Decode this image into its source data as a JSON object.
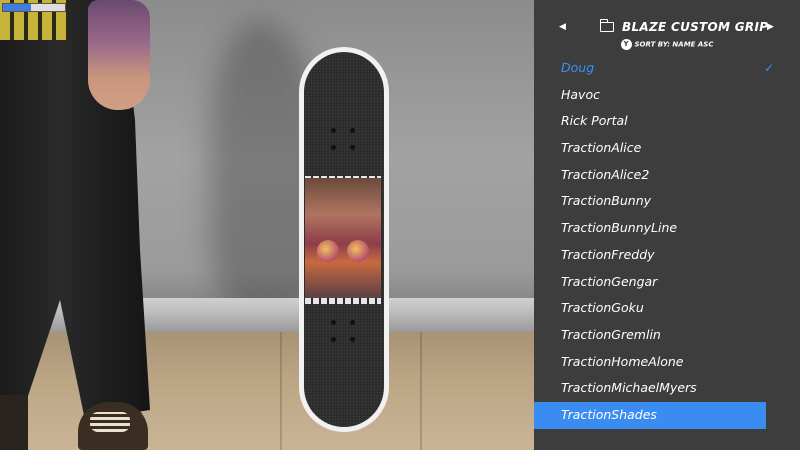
{
  "hud": {
    "progress": 0.45
  },
  "menu": {
    "title": "BLAZE CUSTOM GRIP",
    "sort_button": "Y",
    "sort_label": "SORT BY: NAME ASC",
    "prev_arrow": "◀",
    "next_arrow": "▶",
    "check_glyph": "✓",
    "items": [
      "Doug",
      "Havoc",
      "Rick Portal",
      "TractionAlice",
      "TractionAlice2",
      "TractionBunny",
      "TractionBunnyLine",
      "TractionFreddy",
      "TractionGengar",
      "TractionGoku",
      "TractionGremlin",
      "TractionHomeAlone",
      "TractionMichaelMyers",
      "TractionShades"
    ],
    "equipped_item": "Doug",
    "highlighted_item": "TractionShades",
    "accent_color": "#3b8cf0",
    "panel_color": "#3d3d3d"
  },
  "icons": [
    "folder-icon",
    "chevron-left-icon",
    "chevron-right-icon",
    "checkmark-icon",
    "y-button-icon"
  ]
}
